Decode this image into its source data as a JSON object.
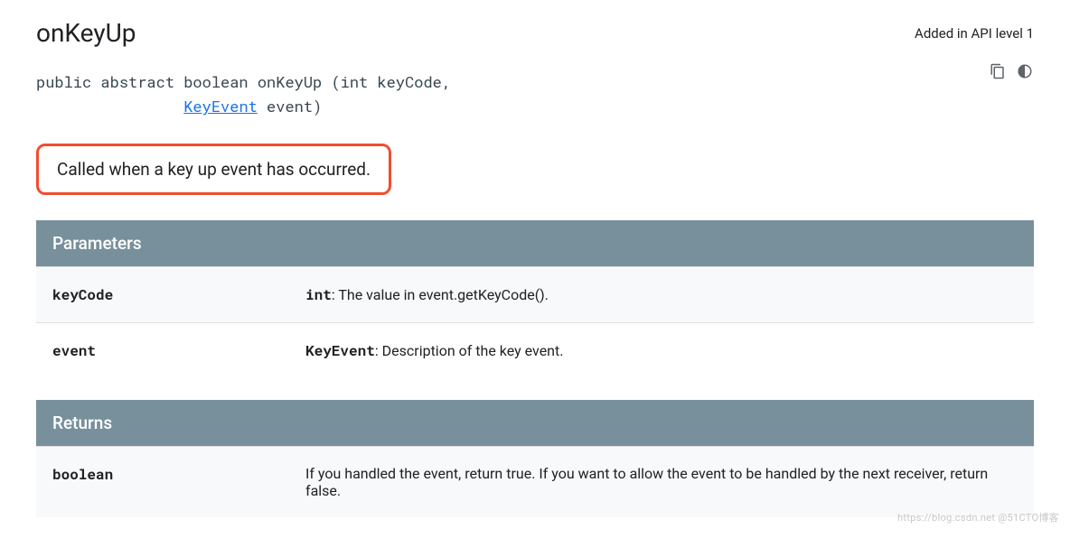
{
  "header": {
    "title": "onKeyUp",
    "api_level": "Added in API level 1"
  },
  "actions": {
    "copy_label": "Copy",
    "theme_label": "Toggle theme"
  },
  "signature": {
    "prefix": "public abstract boolean onKeyUp (int keyCode,",
    "indent": "                ",
    "type_link": "KeyEvent",
    "suffix": " event)"
  },
  "description": "Called when a key up event has occurred.",
  "parameters": {
    "heading": "Parameters",
    "rows": [
      {
        "name": "keyCode",
        "type": "int",
        "desc": ": The value in event.getKeyCode()."
      },
      {
        "name": "event",
        "type": "KeyEvent",
        "desc": ": Description of the key event."
      }
    ]
  },
  "returns": {
    "heading": "Returns",
    "rows": [
      {
        "name": "boolean",
        "desc": "If you handled the event, return true. If you want to allow the event to be handled by the next receiver, return false."
      }
    ]
  },
  "watermark": "https://blog.csdn.net @51CTO博客"
}
